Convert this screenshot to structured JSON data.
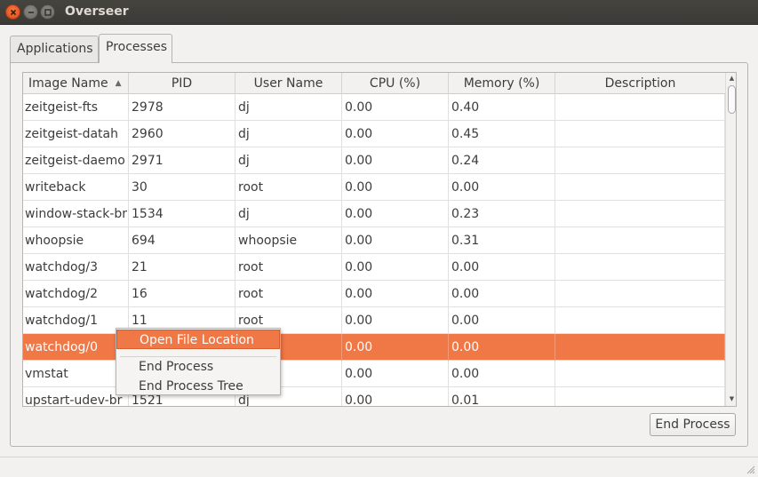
{
  "window": {
    "title": "Overseer"
  },
  "tabs": [
    {
      "label": "Applications"
    },
    {
      "label": "Processes"
    }
  ],
  "table": {
    "columns": [
      "Image Name",
      "PID",
      "User Name",
      "CPU (%)",
      "Memory (%)",
      "Description"
    ],
    "sort_column": "Image Name",
    "sort_icon": "sort-ascending-icon",
    "rows": [
      {
        "name": "zeitgeist-fts",
        "pid": "2978",
        "user": "dj",
        "cpu": "0.00",
        "mem": "0.40",
        "desc": ""
      },
      {
        "name": "zeitgeist-datah",
        "pid": "2960",
        "user": "dj",
        "cpu": "0.00",
        "mem": "0.45",
        "desc": ""
      },
      {
        "name": "zeitgeist-daemo",
        "pid": "2971",
        "user": "dj",
        "cpu": "0.00",
        "mem": "0.24",
        "desc": ""
      },
      {
        "name": "writeback",
        "pid": "30",
        "user": "root",
        "cpu": "0.00",
        "mem": "0.00",
        "desc": ""
      },
      {
        "name": "window-stack-br",
        "pid": "1534",
        "user": "dj",
        "cpu": "0.00",
        "mem": "0.23",
        "desc": ""
      },
      {
        "name": "whoopsie",
        "pid": "694",
        "user": "whoopsie",
        "cpu": "0.00",
        "mem": "0.31",
        "desc": ""
      },
      {
        "name": "watchdog/3",
        "pid": "21",
        "user": "root",
        "cpu": "0.00",
        "mem": "0.00",
        "desc": ""
      },
      {
        "name": "watchdog/2",
        "pid": "16",
        "user": "root",
        "cpu": "0.00",
        "mem": "0.00",
        "desc": ""
      },
      {
        "name": "watchdog/1",
        "pid": "11",
        "user": "root",
        "cpu": "0.00",
        "mem": "0.00",
        "desc": ""
      },
      {
        "name": "watchdog/0",
        "pid": "",
        "user": "",
        "cpu": "0.00",
        "mem": "0.00",
        "desc": ""
      },
      {
        "name": "vmstat",
        "pid": "",
        "user": "",
        "cpu": "0.00",
        "mem": "0.00",
        "desc": ""
      },
      {
        "name": "upstart-udev-br",
        "pid": "1521",
        "user": "dj",
        "cpu": "0.00",
        "mem": "0.01",
        "desc": ""
      }
    ],
    "selected_row": "watchdog/0"
  },
  "context_menu": {
    "items": [
      "Open File Location",
      "End Process",
      "End Process Tree"
    ],
    "highlighted": "Open File Location"
  },
  "buttons": {
    "end_process": "End Process"
  },
  "colors": {
    "selection": "#f07746",
    "close_button": "#dd4814",
    "titlebar": "#3c3b37"
  }
}
